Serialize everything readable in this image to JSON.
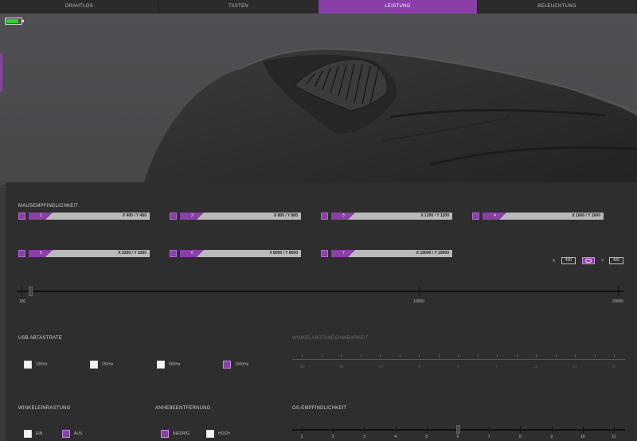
{
  "tabs": [
    {
      "label": "DRAHTLOS",
      "active": false
    },
    {
      "label": "TASTEN",
      "active": false
    },
    {
      "label": "LEISTUNG",
      "active": true
    },
    {
      "label": "BELEUCHTUNG",
      "active": false
    }
  ],
  "battery": {
    "level": 0.85,
    "color": "#2ed12e"
  },
  "accent_color": "#8a3fa8",
  "sensitivity": {
    "title": "MAUSEMPFINDLICHKEIT",
    "levels": [
      {
        "num": "1",
        "value": "X 400 / Y 400"
      },
      {
        "num": "2",
        "value": "X 800 / Y 800"
      },
      {
        "num": "3",
        "value": "X 1200 / Y 1200"
      },
      {
        "num": "4",
        "value": "X 1600 / Y 1600"
      },
      {
        "num": "5",
        "value": "X 3200 / Y 3200"
      },
      {
        "num": "6",
        "value": "X 8000 / Y 8000"
      },
      {
        "num": "7",
        "value": "X 19000 / Y 19000"
      }
    ],
    "x_label": "X",
    "x_value": "400",
    "y_label": "Y",
    "y_value": "400",
    "link_icon": "link-icon",
    "slider": {
      "min": "100",
      "mid": "10000",
      "max": "20000",
      "value": 400
    }
  },
  "polling": {
    "title": "USB ABTASTRATE",
    "options": [
      {
        "label": "125Hz",
        "selected": false
      },
      {
        "label": "250Hz",
        "selected": false
      },
      {
        "label": "500Hz",
        "selected": false
      },
      {
        "label": "1000Hz",
        "selected": true
      }
    ]
  },
  "angle_snap_speed": {
    "title": "WINKELABSTANDSINNBARKEIT",
    "labels": [
      "-20",
      "-15",
      "-10",
      "-5",
      "0",
      "5",
      "10",
      "15",
      "20"
    ]
  },
  "angle_snapping": {
    "title": "WINKELEINRASTUNG",
    "options": [
      {
        "label": "EIN",
        "selected": false
      },
      {
        "label": "AUS",
        "selected": true
      }
    ]
  },
  "lift_off": {
    "title": "ANHEBEENTFERNUNG",
    "options": [
      {
        "label": "NIEDRIG",
        "selected": true
      },
      {
        "label": "HOCH",
        "selected": false
      }
    ]
  },
  "os_sensitivity": {
    "title": "OS-EMPFINDLICHKEIT",
    "labels": [
      "1",
      "2",
      "3",
      "4",
      "5",
      "6",
      "7",
      "8",
      "9",
      "10",
      "11"
    ],
    "value": 6
  }
}
